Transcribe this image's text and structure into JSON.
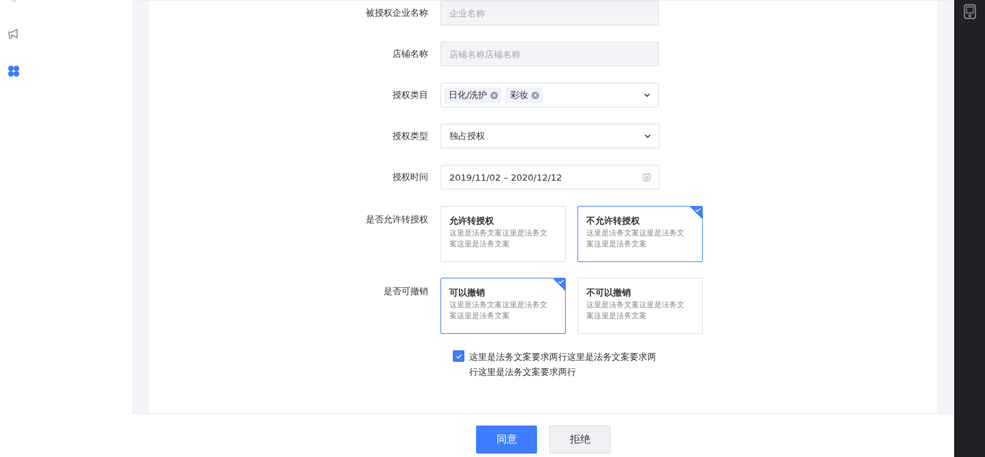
{
  "sidebar": {
    "items": [
      {
        "selected": false
      },
      {
        "selected": false
      },
      {
        "selected": true
      }
    ]
  },
  "form": {
    "fields": [
      {
        "kind": "input",
        "label": "被授权企业名称",
        "placeholder": "企业名称",
        "disabled": true
      },
      {
        "kind": "input",
        "label": "店铺名称",
        "placeholder": "店铺名称店铺名称",
        "disabled": true
      },
      {
        "kind": "tags",
        "label": "授权类目",
        "tags": [
          {
            "text": "日化/洗护"
          },
          {
            "text": "彩妆"
          }
        ]
      },
      {
        "kind": "select",
        "label": "授权类型",
        "value": "独占授权"
      },
      {
        "kind": "daterange",
        "label": "授权时间",
        "value": "2019/11/02 – 2020/12/12"
      },
      {
        "kind": "cards",
        "label": "是否允许转授权",
        "options": [
          {
            "title": "允许转授权",
            "description": "这里是法务文案这里是法务文案这里是法务文案",
            "selected": false
          },
          {
            "title": "不允许转授权",
            "description": "这里是法务文案这里是法务文案这里是法务文案",
            "selected": true
          }
        ]
      },
      {
        "kind": "cards",
        "label": "是否可撤销",
        "options": [
          {
            "title": "可以撤销",
            "description": "这里是法务文案这里是法务文案这里是法务文案",
            "selected": true
          },
          {
            "title": "不可以撤销",
            "description": "这里是法务文案这里是法务文案这里是法务文案",
            "selected": false
          }
        ]
      }
    ],
    "agreement": {
      "text": "这里是法务文案要求两行这里是法务文案要求两行这里是法务文案要求两行",
      "checked": true
    }
  },
  "buttons": [
    {
      "label": "同意",
      "kind": "primary"
    },
    {
      "label": "拒绝",
      "kind": "default"
    }
  ]
}
